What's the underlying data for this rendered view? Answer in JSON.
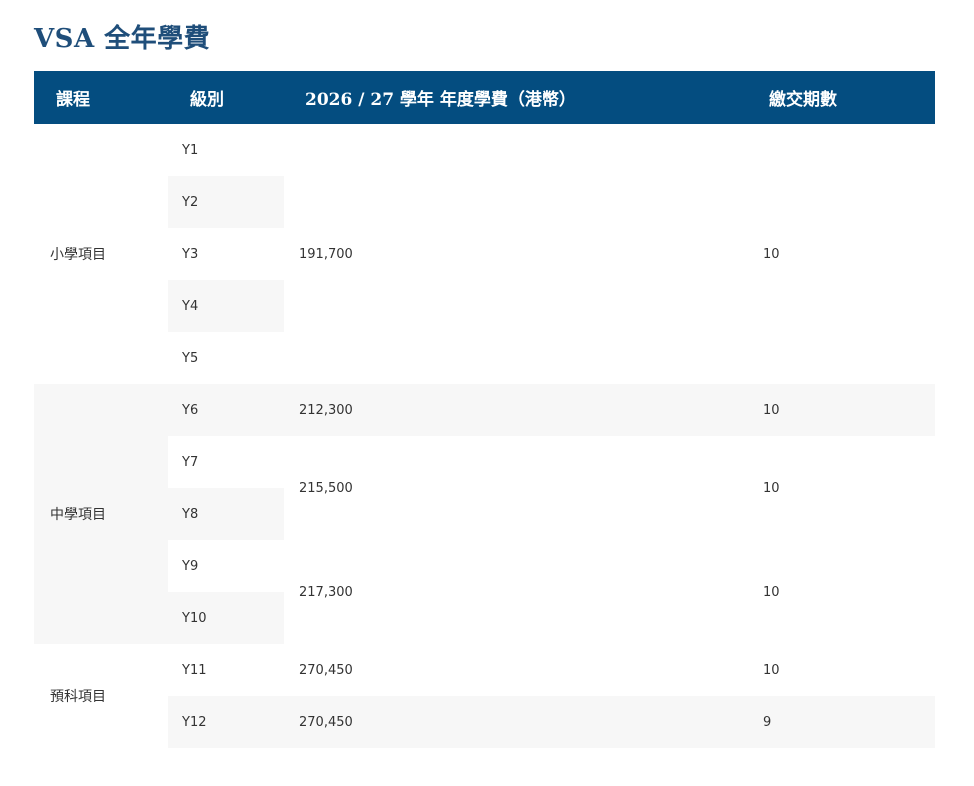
{
  "title": "VSA 全年學費",
  "table": {
    "headers": {
      "program": "課程",
      "level": "級別",
      "fee": "2026 / 27 學年 年度學費（港幣）",
      "installments": "繳交期數"
    },
    "programs": {
      "primary": "小學項目",
      "secondary": "中學項目",
      "prep": "預科項目"
    },
    "levels": [
      "Y1",
      "Y2",
      "Y3",
      "Y4",
      "Y5",
      "Y6",
      "Y7",
      "Y8",
      "Y9",
      "Y10",
      "Y11",
      "Y12"
    ],
    "fees": {
      "primary": "191,700",
      "y6": "212,300",
      "y7_y8": "215,500",
      "y9_y10": "217,300",
      "y11": "270,450",
      "y12": "270,450"
    },
    "installments": {
      "primary": "10",
      "y6": "10",
      "y7_y8": "10",
      "y9_y10": "10",
      "y11": "10",
      "y12": "9"
    }
  },
  "colors": {
    "header_bg": "#044d80",
    "title": "#1f4e7a",
    "stripe": "#f7f7f7"
  }
}
